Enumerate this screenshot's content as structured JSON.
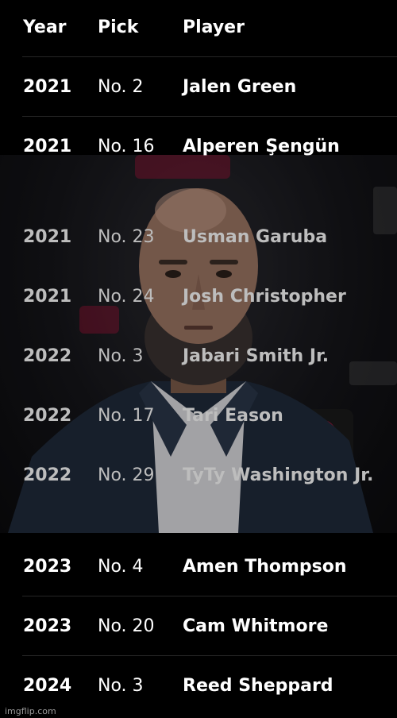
{
  "columns": {
    "year": "Year",
    "pick": "Pick",
    "player": "Player"
  },
  "rows": [
    {
      "year": "2021",
      "pick": "No. 2",
      "player": "Jalen Green"
    },
    {
      "year": "2021",
      "pick": "No. 16",
      "player": "Alperen Şengün"
    },
    {
      "year": "2021",
      "pick": "No. 23",
      "player": "Usman Garuba"
    },
    {
      "year": "2021",
      "pick": "No. 24",
      "player": "Josh Christopher"
    },
    {
      "year": "2022",
      "pick": "No. 3",
      "player": "Jabari Smith Jr."
    },
    {
      "year": "2022",
      "pick": "No. 17",
      "player": "Tari Eason"
    },
    {
      "year": "2022",
      "pick": "No. 29",
      "player": "TyTy Washington Jr."
    },
    {
      "year": "2023",
      "pick": "No. 4",
      "player": "Amen Thompson"
    },
    {
      "year": "2023",
      "pick": "No. 20",
      "player": "Cam Whitmore"
    },
    {
      "year": "2024",
      "pick": "No. 3",
      "player": "Reed Sheppard"
    }
  ],
  "watermark": "imgflip.com",
  "colors": {
    "background": "#000000",
    "text": "#ffffff",
    "dim_text": "#bdbdbd",
    "rockets_red": "#ce1141"
  },
  "photo": {
    "icon": "person-photo"
  }
}
